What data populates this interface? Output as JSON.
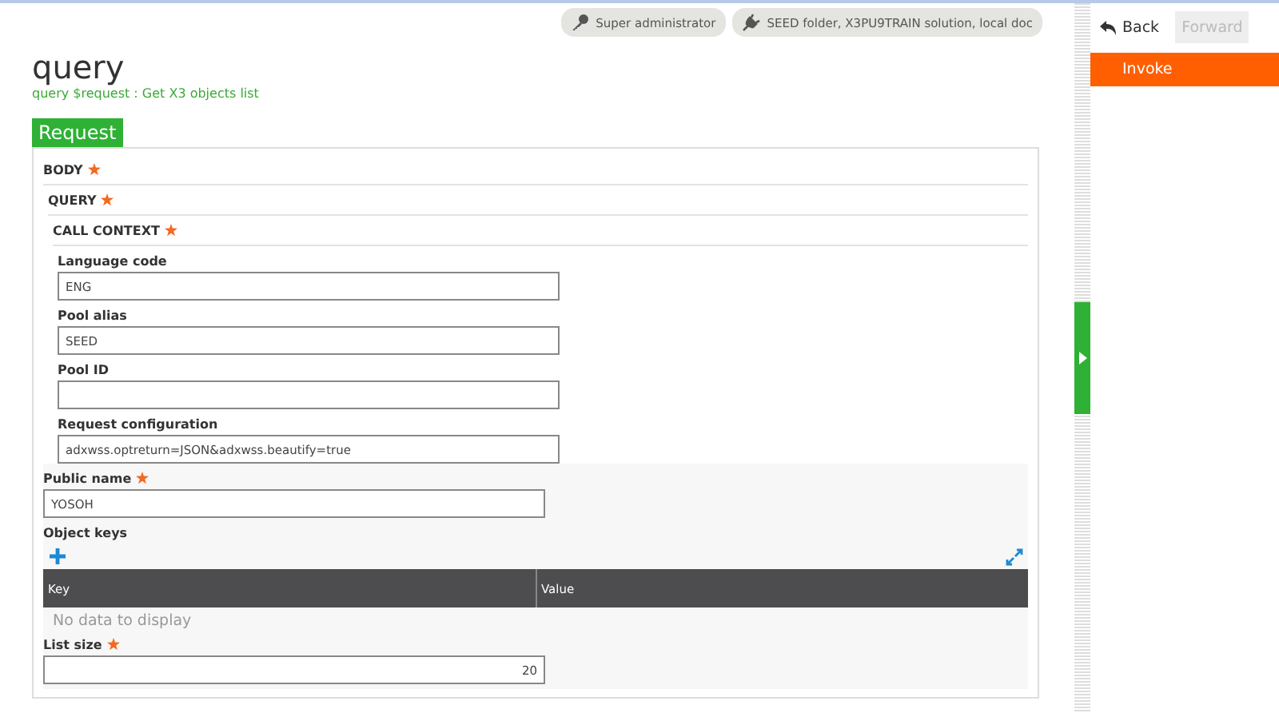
{
  "header_badges": [
    {
      "kind": "key",
      "label": "Super administrator"
    },
    {
      "kind": "plug",
      "label": "SEED folder, X3PU9TRAIN solution, local doc"
    }
  ],
  "title": "query",
  "subtitle": "query $request : Get X3 objects list",
  "tabs": [
    {
      "label": "Request",
      "selected": true
    }
  ],
  "sections": [
    {
      "label": "BODY",
      "required": true
    },
    {
      "label": "QUERY",
      "required": true
    },
    {
      "label": "CALL CONTEXT",
      "required": true
    }
  ],
  "context_fields": [
    {
      "label": "Language code",
      "value": "ENG"
    },
    {
      "label": "Pool alias",
      "value": "SEED"
    },
    {
      "label": "Pool ID"
    },
    {
      "label": "Request configuration",
      "value": "adxwss.optreturn=JSON&adxwss.beautify=true"
    }
  ],
  "public_name": {
    "label": "Public name",
    "required": true,
    "value": "YOSOH"
  },
  "object_keys": {
    "label": "Object keys",
    "columns": [
      "Key",
      "Value"
    ],
    "empty_text": "No data to display"
  },
  "list_size": {
    "label": "List size",
    "required": true,
    "value": "20"
  },
  "side_panel": {
    "back": {
      "label": "Back",
      "disabled": false
    },
    "forward": {
      "label": "Forward",
      "disabled": true
    },
    "actions": [
      {
        "label": "Invoke",
        "selected": true
      }
    ]
  }
}
